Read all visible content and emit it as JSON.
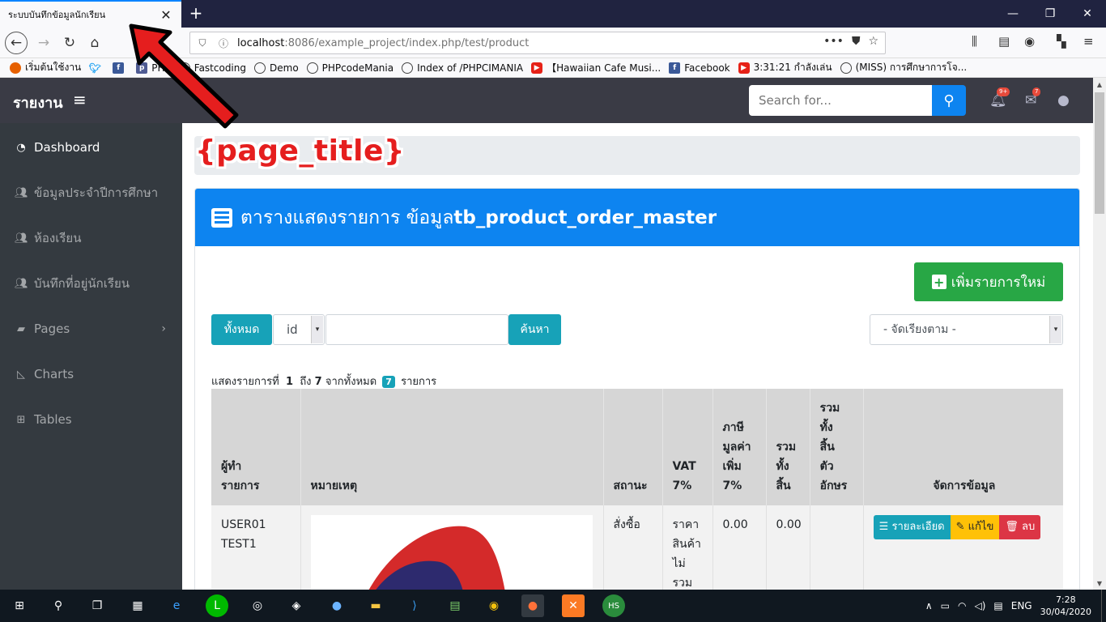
{
  "browser": {
    "tab_title": "ระบบบันทึกข้อมูลนักเรียน",
    "url_host": "localhost",
    "url_path": ":8086/example_project/index.php/test/product"
  },
  "bookmarks": [
    {
      "label": "เริ่มต้นใช้งาน",
      "icon": "firefox-icon"
    },
    {
      "label": "",
      "icon": "twitter-icon"
    },
    {
      "label": "",
      "icon": "facebook-icon"
    },
    {
      "label": "PHP",
      "icon": "php-icon"
    },
    {
      "label": "Fastcoding",
      "icon": "globe-icon"
    },
    {
      "label": "Demo",
      "icon": "globe-icon"
    },
    {
      "label": "PHPcodeMania",
      "icon": "globe-icon"
    },
    {
      "label": "Index of /PHPCIMANIA",
      "icon": "globe-icon"
    },
    {
      "label": "【Hawaiian Cafe Musi...",
      "icon": "youtube-icon"
    },
    {
      "label": "Facebook",
      "icon": "facebook-icon"
    },
    {
      "label": "3:31:21 กำลังเล่น",
      "icon": "youtube-icon"
    },
    {
      "label": "(MISS) การศึกษาการโจ...",
      "icon": "globe-icon"
    }
  ],
  "topbar": {
    "brand": "รายงาน",
    "search_placeholder": "Search for...",
    "alerts_badge": "9+",
    "messages_badge": "7"
  },
  "sidebar": {
    "items": [
      {
        "label": "Dashboard",
        "icon": "tachometer-icon"
      },
      {
        "label": "ข้อมูลประจำปีการศึกษา",
        "icon": "users-icon"
      },
      {
        "label": "ห้องเรียน",
        "icon": "users-icon"
      },
      {
        "label": "บันทึกที่อยู่นักเรียน",
        "icon": "users-icon"
      },
      {
        "label": "Pages",
        "icon": "folder-icon"
      },
      {
        "label": "Charts",
        "icon": "chart-area-icon"
      },
      {
        "label": "Tables",
        "icon": "table-icon"
      }
    ]
  },
  "page": {
    "title": "{page_title}",
    "card_title_prefix": "ตารางแสดงรายการ ข้อมูล",
    "card_title_table": "tb_product_order_master",
    "add_button": "เพิ่มรายการใหม่",
    "all_button": "ทั้งหมด",
    "field_select": "id",
    "search_button": "ค้นหา",
    "sort_select": "- จัดเรียงตาม -",
    "summary": {
      "prefix": "แสดงรายการที่",
      "from": "1",
      "mid": "ถึง",
      "to": "7",
      "of": "จากทั้งหมด",
      "total": "7",
      "suffix": "รายการ"
    }
  },
  "table": {
    "headers": [
      "ผู้ทำ\nรายการ",
      "หมายเหตุ",
      "สถานะ",
      "VAT\n7%",
      "ภาษี\nมูลค่า\nเพิ่ม\n7%",
      "รวม\nทั้ง\nสิ้น",
      "รวม\nทั้ง\nสิ้น\nตัว\nอักษร",
      "จัดการข้อมูล"
    ],
    "rows": [
      {
        "user": "USER01\nTEST1",
        "status": "สั่งซื้อ",
        "vat": "ราคา\nสินค้า\nไม่\nรวม",
        "tax": "0.00",
        "total": "0.00",
        "total_text": ""
      }
    ],
    "actions": {
      "detail": "รายละเอียด",
      "edit": "แก้ไข",
      "delete": "ลบ"
    }
  },
  "taskbar": {
    "lang": "ENG",
    "time": "7:28",
    "date": "30/04/2020"
  },
  "colors": {
    "primary": "#0d84f0",
    "success": "#28a745",
    "info": "#17a2b8",
    "warning": "#ffc107",
    "danger": "#dc3545",
    "sidebar": "#343a40",
    "annotation_red": "#e51e1e"
  }
}
